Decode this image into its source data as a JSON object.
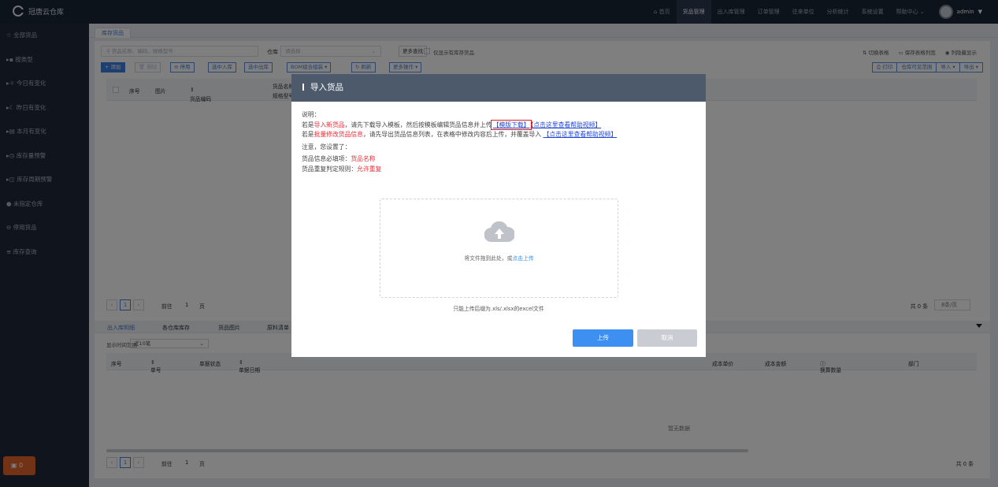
{
  "app": {
    "title": "冠唐云仓库"
  },
  "topnav": {
    "items": [
      "首页",
      "货品管理",
      "出入库管理",
      "订单管理",
      "往来单位",
      "分析统计",
      "系统设置",
      "帮助中心"
    ],
    "active": "货品管理",
    "user": "admin"
  },
  "sidebar": {
    "items": [
      "全部货品",
      "按类型",
      "今日有变化",
      "昨日有变化",
      "本月有变化",
      "库存量预警",
      "库存周期预警",
      "未指定仓库",
      "停用货品",
      "库存查询"
    ],
    "badge": "0"
  },
  "tabs": {
    "current": "库存货品"
  },
  "toolbar": {
    "search_placeholder": "货品名称、编码、规格型号",
    "warehouse_label": "仓库",
    "warehouse_placeholder": "请选择",
    "more_search": "更多查找",
    "only_stock": "仅显示有库存货品",
    "switch_table": "切换表格",
    "save_width": "保存表格列宽",
    "hide_cols": "列隐藏显示"
  },
  "actions": {
    "add": "+ 添加",
    "delete": "删除",
    "disable": "停用",
    "selected_in": "选中入库",
    "selected_out": "选中出库",
    "bom": "BOM组合组装",
    "refresh": "刷新",
    "more": "更多操作",
    "print": "打印",
    "visible_range": "仓库可见范围",
    "import": "导入",
    "export": "导出"
  },
  "grid": {
    "columns": [
      "序号",
      "图片",
      "货品编码",
      "货品名称",
      "规格型号"
    ]
  },
  "pager": {
    "page": "1",
    "goto": "前往",
    "page_unit": "页",
    "total": "共 0 条",
    "page_size": "8条/页"
  },
  "bottom_tabs": [
    "出入库明细",
    "各仓库库存",
    "货品图片",
    "原料清单"
  ],
  "range": {
    "label": "显示时间范围",
    "value": "近10笔"
  },
  "grid2": {
    "columns": [
      "序号",
      "单号",
      "单据状态",
      "单据日期",
      "成本单价",
      "成本金额",
      "换算数量",
      "部门"
    ],
    "empty": "暂无数据",
    "total": "共 0 条"
  },
  "modal": {
    "title": "导入货品",
    "desc_label": "说明：",
    "line1_prefix": "若是",
    "line1_red": "导入新货品",
    "line1_mid": "，请先下载导入模板，然后按模板编辑货品信息并上传",
    "template_link": "【模版下载】",
    "help_link": "【点击这里查看帮助视频】",
    "line2_prefix": "若是",
    "line2_red": "批量修改货品信息",
    "line2_mid": "，请先导出货品信息列表，在表格中修改内容后上传，并覆盖导入",
    "help_link2": "【点击这里查看帮助视频】",
    "note": "注意，您设置了：",
    "required_label": "货品信息必填项：",
    "required_value": "货品名称",
    "dup_label": "货品重复判定规则：",
    "dup_value": "允许重复",
    "upload_text": "将文件拖到此处，或",
    "upload_link": "点击上传",
    "tip": "只能上传后缀为.xls/.xlsx的excel文件",
    "btn_upload": "上传",
    "btn_cancel": "取消"
  }
}
